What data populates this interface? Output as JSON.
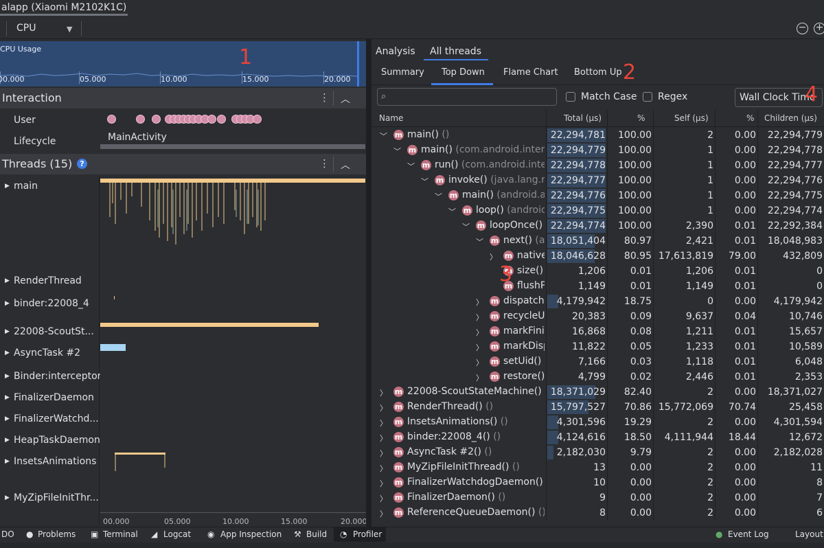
{
  "window": {
    "title": "alapp (Xiaomi M2102K1C)"
  },
  "toolbar": {
    "cpu_label": "CPU",
    "zoom_out": "−",
    "zoom_in": "+"
  },
  "cpu_usage": {
    "label": "CPU Usage",
    "ticks": [
      "00.000",
      "05.000",
      "10.000",
      "15.000",
      "20.000"
    ]
  },
  "annotations": [
    "1",
    "2",
    "3",
    "4"
  ],
  "interaction": {
    "title": "Interaction",
    "user_label": "User",
    "lifecycle_label": "Lifecycle",
    "activity": "MainActivity"
  },
  "threads": {
    "title": "Threads (15)",
    "help": "?",
    "list": [
      "main",
      "RenderThread",
      "binder:22008_4",
      "22008-ScoutSt...",
      "AsyncTask #2",
      "Binder:interceptor",
      "FinalizerDaemon",
      "FinalizerWatchd...",
      "HeapTaskDaemon",
      "InsetsAnimations",
      "MyZipFileInitThr..."
    ],
    "ticks": [
      "00.000",
      "05.000",
      "10.000",
      "15.000",
      "20.000"
    ]
  },
  "analysis": {
    "tabs": [
      "Analysis",
      "All threads"
    ],
    "subtabs": [
      "Summary",
      "Top Down",
      "Flame Chart",
      "Bottom Up"
    ],
    "search_placeholder": "",
    "match_case": "Match Case",
    "regex": "Regex",
    "clock": "Wall Clock Time"
  },
  "table": {
    "columns": [
      "Name",
      "Total (µs)",
      "%",
      "Self (µs)",
      "%",
      "Children (µs)"
    ],
    "rows": [
      {
        "depth": 0,
        "expanded": true,
        "name": "main()",
        "pkg": "()",
        "total": "22,294,781",
        "pct": "100.00",
        "self": "2",
        "spct": "0.00",
        "children": "22,294,779",
        "frac": 1.0
      },
      {
        "depth": 1,
        "expanded": true,
        "name": "main()",
        "pkg": "(com.android.interr",
        "total": "22,294,779",
        "pct": "100.00",
        "self": "1",
        "spct": "0.00",
        "children": "22,294,778",
        "frac": 1.0
      },
      {
        "depth": 2,
        "expanded": true,
        "name": "run()",
        "pkg": "(com.android.inte",
        "total": "22,294,778",
        "pct": "100.00",
        "self": "1",
        "spct": "0.00",
        "children": "22,294,777",
        "frac": 1.0
      },
      {
        "depth": 3,
        "expanded": true,
        "name": "invoke()",
        "pkg": "(java.lang.re",
        "total": "22,294,777",
        "pct": "100.00",
        "self": "1",
        "spct": "0.00",
        "children": "22,294,776",
        "frac": 1.0
      },
      {
        "depth": 4,
        "expanded": true,
        "name": "main()",
        "pkg": "(android.a",
        "total": "22,294,776",
        "pct": "100.00",
        "self": "1",
        "spct": "0.00",
        "children": "22,294,775",
        "frac": 1.0
      },
      {
        "depth": 5,
        "expanded": true,
        "name": "loop()",
        "pkg": "(android",
        "total": "22,294,775",
        "pct": "100.00",
        "self": "1",
        "spct": "0.00",
        "children": "22,294,774",
        "frac": 1.0
      },
      {
        "depth": 6,
        "expanded": true,
        "name": "loopOnce()",
        "pkg": "",
        "total": "22,294,774",
        "pct": "100.00",
        "self": "2,390",
        "spct": "0.01",
        "children": "22,292,384",
        "frac": 1.0
      },
      {
        "depth": 7,
        "expanded": true,
        "name": "next()",
        "pkg": "(a",
        "total": "18,051,404",
        "pct": "80.97",
        "self": "2,421",
        "spct": "0.01",
        "children": "18,048,983",
        "frac": 0.81
      },
      {
        "depth": 8,
        "expanded": false,
        "name": "native",
        "pkg": "",
        "total": "18,046,628",
        "pct": "80.95",
        "self": "17,613,819",
        "spct": "79.00",
        "children": "432,809",
        "frac": 0.81
      },
      {
        "depth": 8,
        "expanded": null,
        "name": "size()",
        "pkg": "",
        "total": "1,206",
        "pct": "0.01",
        "self": "1,206",
        "spct": "0.01",
        "children": "0",
        "frac": 0.0
      },
      {
        "depth": 8,
        "expanded": null,
        "name": "flushP",
        "pkg": "",
        "total": "1,149",
        "pct": "0.01",
        "self": "1,149",
        "spct": "0.01",
        "children": "0",
        "frac": 0.0
      },
      {
        "depth": 7,
        "expanded": false,
        "name": "dispatchl",
        "pkg": "",
        "total": "4,179,942",
        "pct": "18.75",
        "self": "0",
        "spct": "0.00",
        "children": "4,179,942",
        "frac": 0.19
      },
      {
        "depth": 7,
        "expanded": false,
        "name": "recycleU",
        "pkg": "",
        "total": "20,383",
        "pct": "0.09",
        "self": "9,637",
        "spct": "0.04",
        "children": "10,746",
        "frac": 0.0
      },
      {
        "depth": 7,
        "expanded": false,
        "name": "markFinis",
        "pkg": "",
        "total": "16,868",
        "pct": "0.08",
        "self": "1,211",
        "spct": "0.01",
        "children": "15,657",
        "frac": 0.0
      },
      {
        "depth": 7,
        "expanded": false,
        "name": "markDisp",
        "pkg": "",
        "total": "11,822",
        "pct": "0.05",
        "self": "1,233",
        "spct": "0.01",
        "children": "10,589",
        "frac": 0.0
      },
      {
        "depth": 7,
        "expanded": false,
        "name": "setUid()",
        "pkg": "",
        "total": "7,166",
        "pct": "0.03",
        "self": "1,118",
        "spct": "0.01",
        "children": "6,048",
        "frac": 0.0
      },
      {
        "depth": 7,
        "expanded": false,
        "name": "restore()",
        "pkg": "",
        "total": "4,799",
        "pct": "0.02",
        "self": "2,446",
        "spct": "0.01",
        "children": "2,353",
        "frac": 0.0
      },
      {
        "depth": 0,
        "expanded": false,
        "name": "22008-ScoutStateMachine()",
        "pkg": "",
        "total": "18,371,029",
        "pct": "82.40",
        "self": "2",
        "spct": "0.00",
        "children": "18,371,027",
        "frac": 0.82
      },
      {
        "depth": 0,
        "expanded": false,
        "name": "RenderThread()",
        "pkg": "()",
        "total": "15,797,527",
        "pct": "70.86",
        "self": "15,772,069",
        "spct": "70.74",
        "children": "25,458",
        "frac": 0.71
      },
      {
        "depth": 0,
        "expanded": false,
        "name": "InsetsAnimations()",
        "pkg": "()",
        "total": "4,301,596",
        "pct": "19.29",
        "self": "2",
        "spct": "0.00",
        "children": "4,301,594",
        "frac": 0.19
      },
      {
        "depth": 0,
        "expanded": false,
        "name": "binder:22008_4()",
        "pkg": "()",
        "total": "4,124,616",
        "pct": "18.50",
        "self": "4,111,944",
        "spct": "18.44",
        "children": "12,672",
        "frac": 0.19
      },
      {
        "depth": 0,
        "expanded": false,
        "name": "AsyncTask #2()",
        "pkg": "()",
        "total": "2,182,030",
        "pct": "9.79",
        "self": "2",
        "spct": "0.00",
        "children": "2,182,028",
        "frac": 0.1
      },
      {
        "depth": 0,
        "expanded": false,
        "name": "MyZipFileInitThread()",
        "pkg": "()",
        "total": "13",
        "pct": "0.00",
        "self": "2",
        "spct": "0.00",
        "children": "11",
        "frac": 0.0
      },
      {
        "depth": 0,
        "expanded": false,
        "name": "FinalizerWatchdogDaemon()",
        "pkg": "",
        "total": "10",
        "pct": "0.00",
        "self": "2",
        "spct": "0.00",
        "children": "8",
        "frac": 0.0
      },
      {
        "depth": 0,
        "expanded": false,
        "name": "FinalizerDaemon()",
        "pkg": "()",
        "total": "9",
        "pct": "0.00",
        "self": "2",
        "spct": "0.00",
        "children": "7",
        "frac": 0.0
      },
      {
        "depth": 0,
        "expanded": false,
        "name": "ReferenceQueueDaemon()",
        "pkg": "()",
        "total": "8",
        "pct": "0.00",
        "self": "2",
        "spct": "0.00",
        "children": "6",
        "frac": 0.0
      }
    ]
  },
  "bottom_tabs": [
    "DO",
    "Problems",
    "Terminal",
    "Logcat",
    "App Inspection",
    "Build",
    "Profiler"
  ],
  "bottom_right": [
    "Event Log",
    "Layout"
  ],
  "colors": {
    "accent": "#3f7ce6",
    "method_icon": "#c0707f",
    "trace": "#f2c98a",
    "cpu_bg": "#2e4a73",
    "annotation": "#e8443a"
  }
}
